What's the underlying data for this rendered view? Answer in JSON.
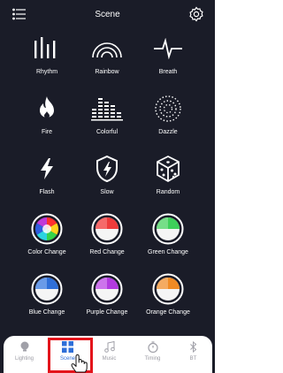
{
  "header": {
    "title": "Scene",
    "menu_icon": "menu-icon",
    "settings_icon": "gear-icon"
  },
  "scenes": [
    {
      "label": "Rhythm",
      "icon": "bars-icon"
    },
    {
      "label": "Rainbow",
      "icon": "rainbow-icon"
    },
    {
      "label": "Breath",
      "icon": "pulse-icon"
    },
    {
      "label": "Fire",
      "icon": "flame-icon"
    },
    {
      "label": "Colorful",
      "icon": "equalizer-icon"
    },
    {
      "label": "Dazzle",
      "icon": "dotted-ring-icon"
    },
    {
      "label": "Flash",
      "icon": "lightning-icon"
    },
    {
      "label": "Slow",
      "icon": "shield-lightning-icon"
    },
    {
      "label": "Random",
      "icon": "dice-icon"
    },
    {
      "label": "Color Change",
      "icon": "color-wheel-icon"
    },
    {
      "label": "Red Change",
      "icon": "red-circle-icon"
    },
    {
      "label": "Green Change",
      "icon": "green-circle-icon"
    },
    {
      "label": "Blue Change",
      "icon": "blue-circle-icon"
    },
    {
      "label": "Purple Change",
      "icon": "purple-circle-icon"
    },
    {
      "label": "Orange Change",
      "icon": "orange-circle-icon"
    }
  ],
  "tabs": [
    {
      "label": "Lighting",
      "icon": "bulb-icon",
      "active": false
    },
    {
      "label": "Scene",
      "icon": "grid-icon",
      "active": true
    },
    {
      "label": "Music",
      "icon": "music-note-icon",
      "active": false
    },
    {
      "label": "Timing",
      "icon": "timer-icon",
      "active": false
    },
    {
      "label": "BT",
      "icon": "bluetooth-icon",
      "active": false
    }
  ],
  "colors": {
    "background": "#1a1c28",
    "accent": "#2f6fd8",
    "highlight": "#e3141b",
    "tab_inactive": "#9a9aa2"
  }
}
